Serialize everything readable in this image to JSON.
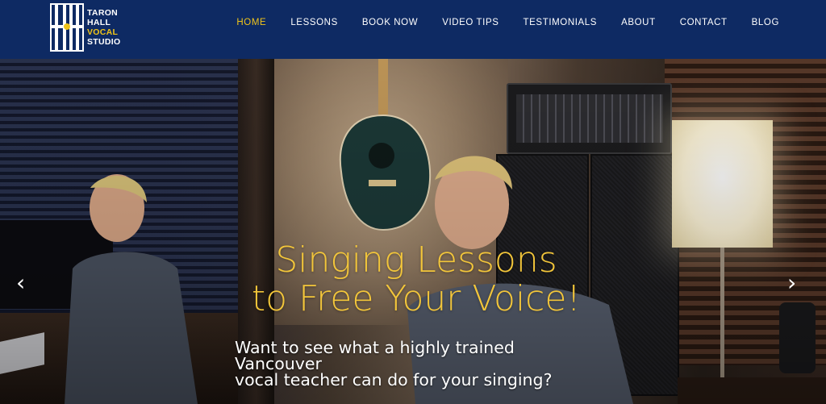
{
  "brand": {
    "line1": "TARON",
    "line2": "HALL",
    "line3": "VOCAL",
    "line4": "STUDIO",
    "colors": {
      "navy": "#0e2a63",
      "gold": "#f0c419",
      "white": "#ffffff"
    }
  },
  "nav": {
    "items": [
      {
        "label": "HOME",
        "active": true
      },
      {
        "label": "LESSONS"
      },
      {
        "label": "BOOK NOW"
      },
      {
        "label": "VIDEO TIPS"
      },
      {
        "label": "TESTIMONIALS"
      },
      {
        "label": "ABOUT"
      },
      {
        "label": "CONTACT"
      },
      {
        "label": "BLOG"
      }
    ]
  },
  "hero": {
    "headline_line1": "Singing Lessons",
    "headline_line2": "to Free Your Voice!",
    "subtitle_line1": "Want to see what a highly trained Vancouver",
    "subtitle_line2": "vocal teacher can do for your singing?",
    "prev_icon": "chevron-left-icon",
    "next_icon": "chevron-right-icon",
    "prev_glyph": "‹",
    "next_glyph": "›"
  }
}
